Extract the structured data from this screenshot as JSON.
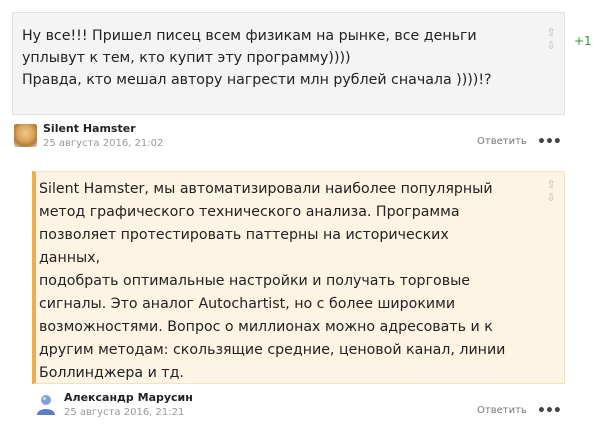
{
  "comment1": {
    "lines": [
      "Ну все!!! Пришел писец всем физикам на рынке, все деньги",
      "уплывут к тем, кто купит эту программу))))",
      "Правда, кто мешал автору нагрести млн рублей сначала ))))!?"
    ],
    "score": "+1",
    "author": "Silent Hamster",
    "date": "25 августа 2016, 21:02",
    "reply_label": "Ответить",
    "more_label": "•••"
  },
  "comment2": {
    "lines": [
      "Silent Hamster, мы автоматизировали наиболее популярный",
      "метод графического технического анализа. Программа",
      "позволяет протестировать паттерны на исторических данных,",
      "подобрать оптимальные настройки и получать торговые",
      "сигналы. Это аналог Autochartist, но с более широкими",
      "возможностями. Вопрос о миллионах можно адресовать и к",
      "другим методам: скользящие средние, ценовой канал, линии",
      "Боллинджера и тд."
    ],
    "author": "Александр Марусин",
    "date": "25 августа 2016, 21:21",
    "reply_label": "Ответить",
    "more_label": "•••"
  },
  "icons": {
    "vote_up": "⇧",
    "vote_down": "⇩",
    "avatar1": "user-photo-avatar",
    "avatar2": "default-user-avatar"
  },
  "colors": {
    "highlight_border": "#f0ad4e",
    "highlight_bg": "#fdf4e3",
    "score": "#2a9d2a"
  }
}
